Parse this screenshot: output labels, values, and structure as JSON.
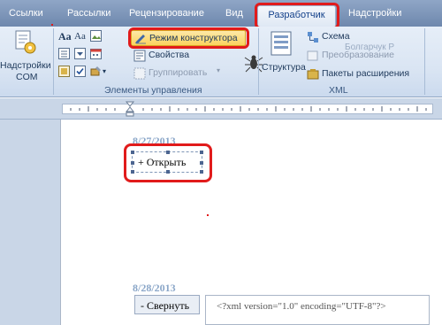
{
  "tabs": [
    {
      "label": "Ссылки"
    },
    {
      "label": "Рассылки"
    },
    {
      "label": "Рецензирование"
    },
    {
      "label": "Вид"
    },
    {
      "label": "Разработчик"
    },
    {
      "label": "Надстройки"
    }
  ],
  "ribbon": {
    "addins": {
      "label_line1": "Надстройки",
      "label_line2": "COM"
    },
    "controls": {
      "design_mode": "Режим конструктора",
      "properties": "Свойства",
      "group": "Группировать",
      "group_label": "Элементы управления"
    },
    "xml": {
      "structure": "Структура",
      "schema": "Схема",
      "transform": "Преобразование",
      "expansion_packs": "Пакеты расширения",
      "group_label": "XML"
    },
    "watermark": "Болгарчук Р"
  },
  "document": {
    "date1": "8/27/2013",
    "open_button": "+ Открыть",
    "date2": "8/28/2013",
    "collapse_button": "- Свернуть",
    "xml_snippet": "<?xml version=\"1.0\" encoding=\"UTF-8\"?>"
  },
  "colors": {
    "highlight_ring": "#e11b1b",
    "active_button": "#fbd35e"
  }
}
